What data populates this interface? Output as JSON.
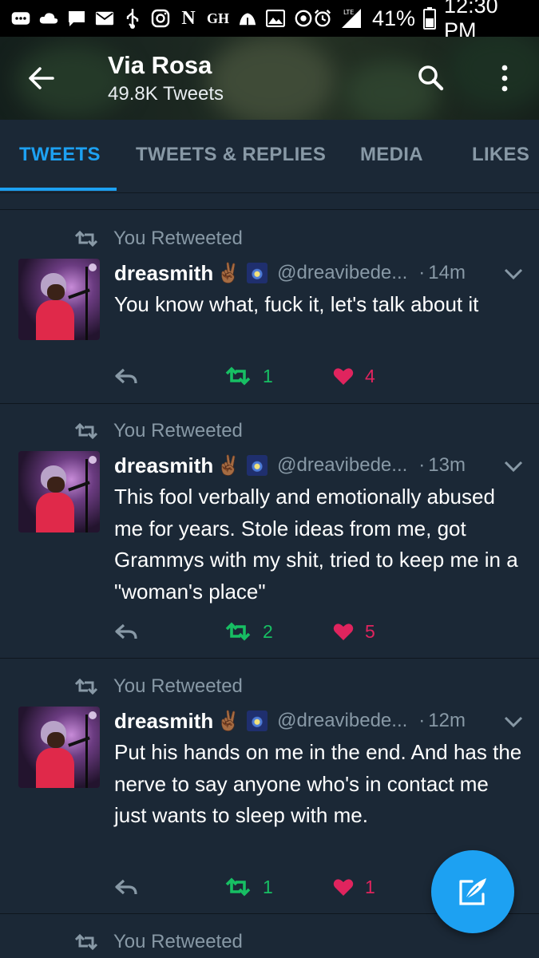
{
  "status_bar": {
    "battery": "41%",
    "time": "12:30 PM",
    "network": "LTE",
    "icons": [
      "more-icon",
      "cloud-icon",
      "chat-icon",
      "mail-icon",
      "usb-icon",
      "instagram-icon",
      "netflix-icon",
      "gh-icon",
      "signal-tower-icon",
      "image-icon",
      "sync-icon",
      "alarm-icon",
      "signal-icon",
      "battery-icon"
    ],
    "left_glyphs": [
      "N",
      "GH"
    ]
  },
  "header": {
    "title": "Via Rosa",
    "subtitle": "49.8K Tweets"
  },
  "tabs": [
    {
      "label": "TWEETS",
      "active": true
    },
    {
      "label": "TWEETS & REPLIES",
      "active": false
    },
    {
      "label": "MEDIA",
      "active": false
    },
    {
      "label": "LIKES",
      "active": false
    }
  ],
  "colors": {
    "background": "#1b2836",
    "accent": "#1da1f2",
    "muted": "#8899a6",
    "retweet_green": "#17bf63",
    "like_pink": "#e0245e"
  },
  "tweets": [
    {
      "retweet_label": "You Retweeted",
      "name": "dreasmith",
      "handle": "@dreavibede...",
      "dot": "·",
      "time": "14m",
      "text": "You know what, fuck it, let's talk about it",
      "retweets": "1",
      "likes": "4"
    },
    {
      "retweet_label": "You Retweeted",
      "name": "dreasmith",
      "handle": "@dreavibede...",
      "dot": "·",
      "time": "13m",
      "text": "This fool verbally and emotionally abused me for years. Stole ideas from me, got Grammys with my shit, tried to keep me in a \"woman's place\"",
      "retweets": "2",
      "likes": "5"
    },
    {
      "retweet_label": "You Retweeted",
      "name": "dreasmith",
      "handle": "@dreavibede...",
      "dot": "·",
      "time": "12m",
      "text": "Put his hands on me in the end. And has the nerve to say anyone who's in contact me just wants to sleep with me.",
      "retweets": "1",
      "likes": "1"
    },
    {
      "retweet_label": "You Retweeted"
    }
  ]
}
